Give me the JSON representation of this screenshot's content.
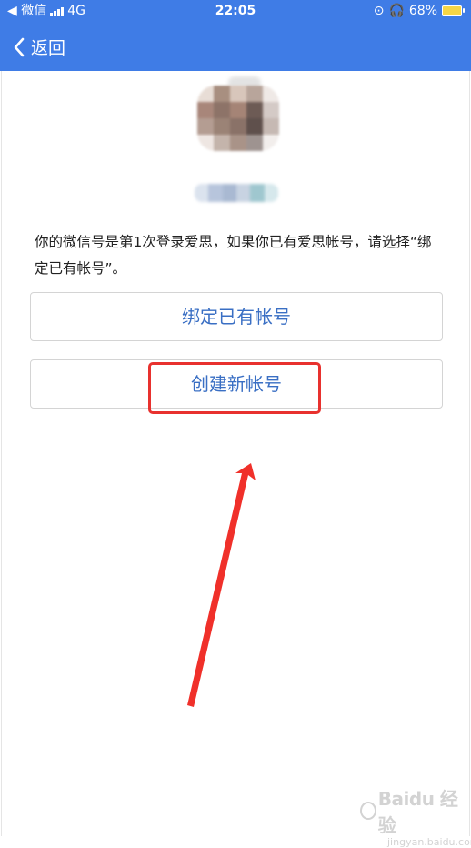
{
  "status_bar": {
    "back_app": "◀ 微信",
    "network": "4G",
    "time": "22:05",
    "battery": "68%"
  },
  "nav": {
    "back_label": "返回"
  },
  "info_text": "你的微信号是第1次登录爱思，如果你已有爱思帐号，请选择“绑定已有帐号”。",
  "buttons": {
    "bind_existing": "绑定已有帐号",
    "create_new": "创建新帐号"
  },
  "annotation": {
    "highlight_color": "#e8312e",
    "arrow_color": "#f0302a"
  },
  "watermark": {
    "brand": "Baidu 经验",
    "url": "jingyan.baidu.com"
  },
  "colors": {
    "header": "#3f7ce6",
    "button_text": "#3a6fc4"
  }
}
